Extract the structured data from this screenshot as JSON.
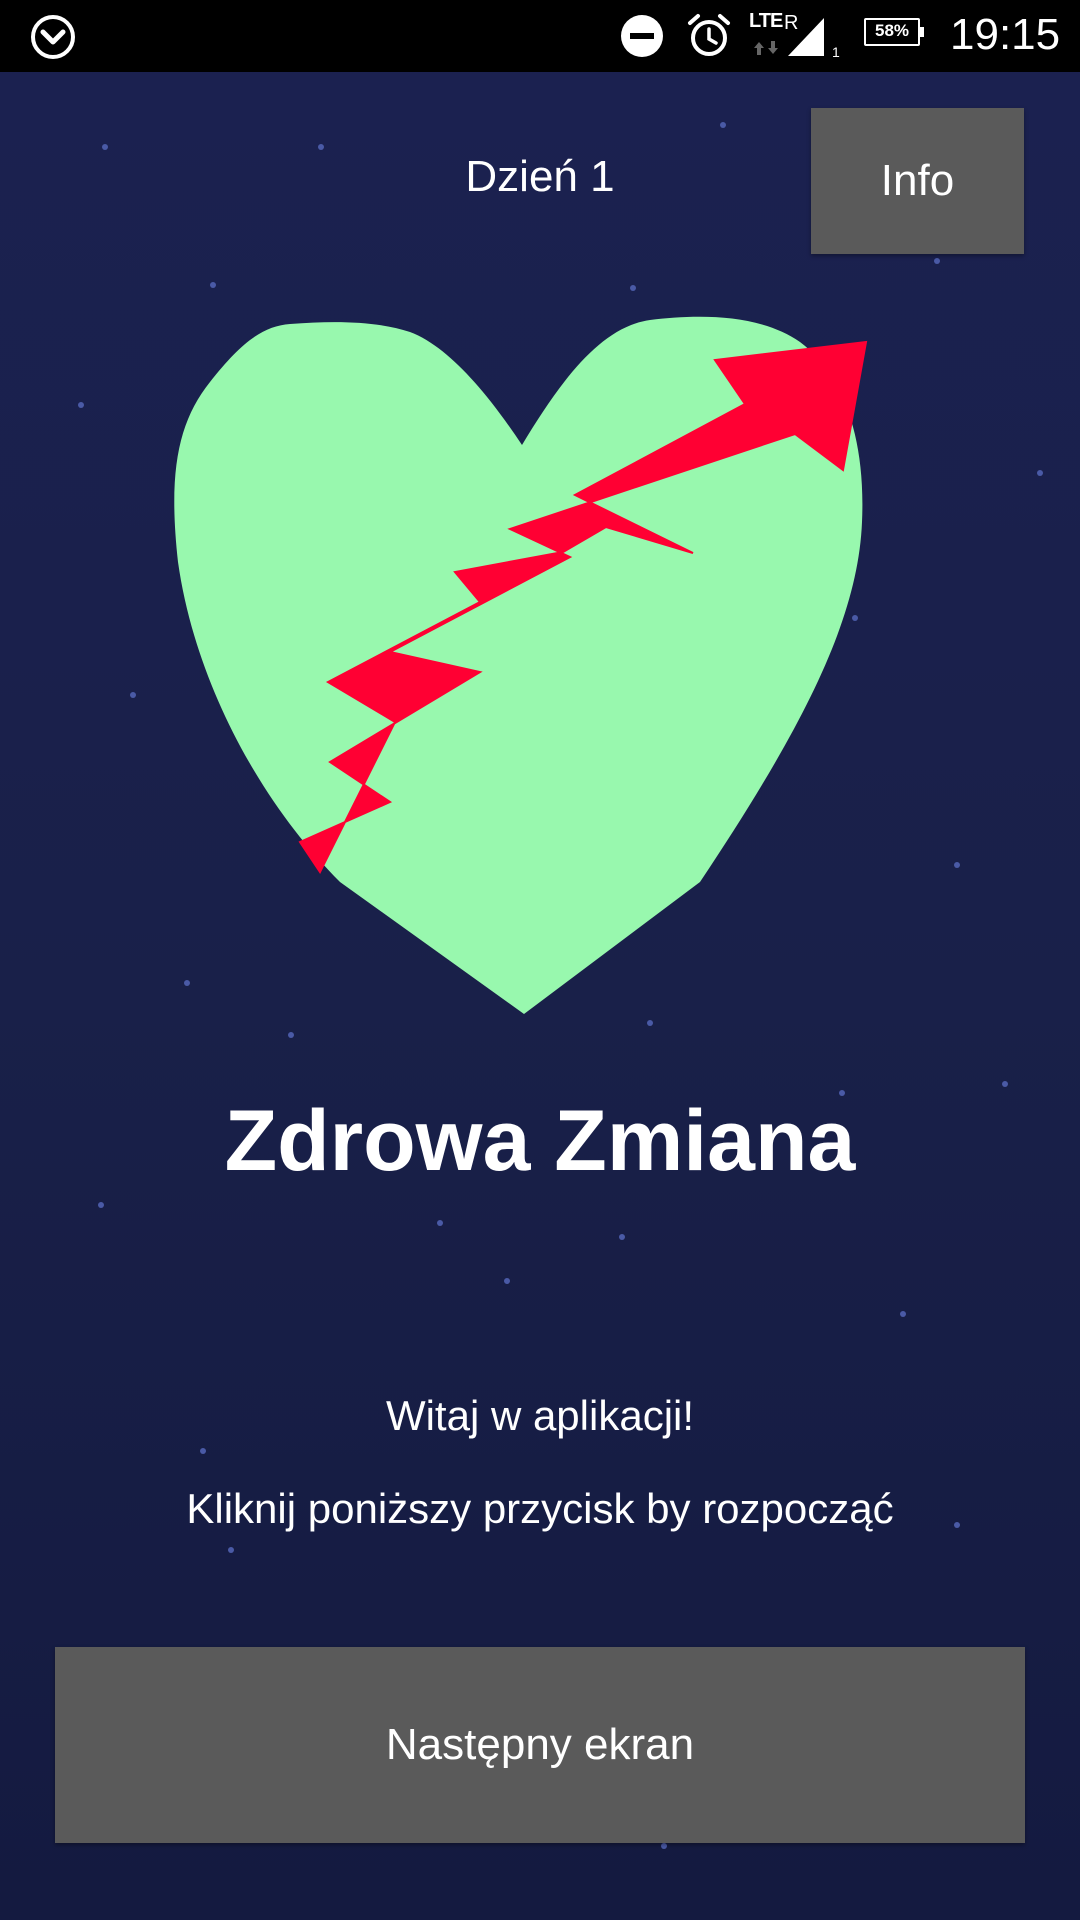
{
  "status_bar": {
    "network_type": "LTE",
    "roaming": "R",
    "sim_slot": "1",
    "battery_percent": "58%",
    "time": "19:15",
    "icons": [
      "app-notification-icon",
      "do-not-disturb-icon",
      "alarm-icon",
      "signal-icon",
      "battery-icon"
    ]
  },
  "header": {
    "day_label": "Dzień 1",
    "info_button": "Info"
  },
  "hero": {
    "image": "heart-with-rising-arrow",
    "heart_color": "#98f8ae",
    "arrow_color": "#ff0033"
  },
  "main": {
    "app_title": "Zdrowa Zmiana",
    "welcome_text": "Witaj w aplikacji!",
    "instruction_text": "Kliknij poniższy przycisk by rozpocząć"
  },
  "footer": {
    "next_button": "Następny ekran"
  },
  "colors": {
    "background": "#1b2150",
    "button": "#5a5a5a",
    "text": "#ffffff"
  }
}
